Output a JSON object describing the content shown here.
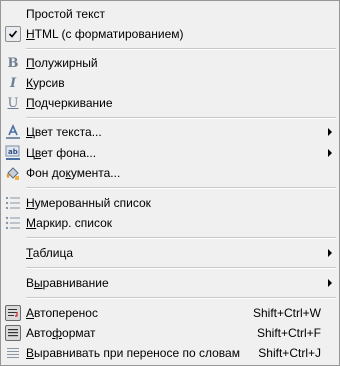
{
  "menu": {
    "format_mode": {
      "plain_text": "Простой текст",
      "html_prefix": "",
      "html_mnemonic": "H",
      "html_rest": "TML (с форматированием)"
    },
    "style": {
      "bold": {
        "mnemonic": "П",
        "rest": "олужирный"
      },
      "italic": {
        "mnemonic": "К",
        "rest": "урсив"
      },
      "underline": {
        "mnemonic": "П",
        "rest": "одчеркивание"
      }
    },
    "colors": {
      "text_color": {
        "prefix": "",
        "mnemonic": "Ц",
        "rest": "вет текста..."
      },
      "bg_color": {
        "prefix": "Ц",
        "mnemonic": "в",
        "rest": "ет фона..."
      },
      "page_bg": {
        "prefix": "Фон до",
        "mnemonic": "к",
        "rest": "умента..."
      }
    },
    "lists": {
      "numbered": {
        "prefix": "",
        "mnemonic": "Н",
        "rest": "умерованный список"
      },
      "bulleted": {
        "prefix": "",
        "mnemonic": "М",
        "rest": "аркир. список"
      }
    },
    "table": {
      "prefix": "",
      "mnemonic": "Т",
      "rest": "аблица"
    },
    "align": {
      "prefix": "В",
      "mnemonic": "ы",
      "rest": "равнивание"
    },
    "autowrap": {
      "prefix": "",
      "mnemonic": "А",
      "rest": "втоперенос",
      "shortcut": "Shift+Ctrl+W"
    },
    "autoformat": {
      "prefix": "Авто",
      "mnemonic": "ф",
      "rest": "ормат",
      "shortcut": "Shift+Ctrl+F"
    },
    "justify_words": {
      "prefix": "",
      "mnemonic": "В",
      "rest": "ыравнивать при переносе по словам",
      "shortcut": "Shift+Ctrl+J"
    }
  },
  "icons": {
    "checkmark": "check-icon",
    "bold": "bold-icon",
    "italic": "italic-icon",
    "underline": "underline-icon",
    "text_color": "text-color-icon",
    "bg_color": "background-color-icon",
    "page_bg": "paint-bucket-icon",
    "numbered": "numbered-list-icon",
    "bulleted": "bulleted-list-icon",
    "autowrap": "autowrap-icon",
    "autoformat": "autoformat-icon",
    "justify": "justify-icon"
  },
  "colors": {
    "menu_bg": "#f0f0f0",
    "border": "#979797",
    "separator": "#c8c8c8",
    "icon_blue": "#4a6fa5",
    "text_color_red": "#d02020"
  }
}
